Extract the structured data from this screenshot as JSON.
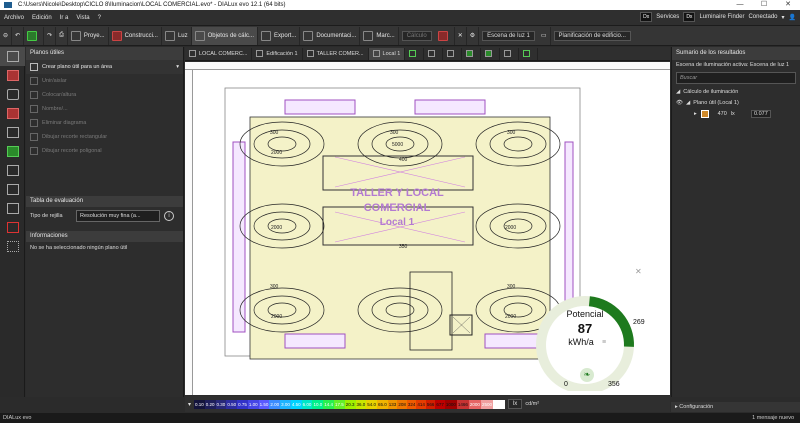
{
  "window": {
    "title": "C:\\Users\\Nicole\\Desktop\\CICLO 8\\Iluminacion\\LOCAL COMERCIAL.evo* - DIALux evo 12.1  (64 bits)"
  },
  "menu": {
    "items": [
      "Archivo",
      "Edición",
      "Ir a",
      "Vista",
      "?"
    ],
    "services": "Services",
    "luminaire_finder": "Luminaire Finder",
    "connection": "Conectado"
  },
  "toolbar": {
    "items": [
      "Proye...",
      "Construcci...",
      "Luz",
      "Objetos de cálc...",
      "Export...",
      "Documentaci...",
      "Marc..."
    ],
    "cálculo": "Cálculo",
    "scene": "Escena de luz 1",
    "building_plan": "Planificación de edificio..."
  },
  "left_panel": {
    "title": "Planos útiles",
    "actions": [
      "Crear plano útil para un área",
      "Unir/aislar",
      "Colocar/altura",
      "Nombre/...",
      "Eliminar diagrama",
      "Dibujar recorte rectangular",
      "Dibujar recorte poligonal"
    ],
    "eval_table_title": "Tabla de evaluación",
    "grid_label": "Tipo de rejilla",
    "grid_value": "Resolución muy fina (a...",
    "info_title": "Informaciones",
    "info_message": "No se ha seleccionado ningún plano útil"
  },
  "view_tabs": [
    "LOCAL COMERC...",
    "Edificación 1",
    "TALLER COMER...",
    "Local 1"
  ],
  "plan": {
    "title_line1": "TALLER Y LOCAL",
    "title_line2": "COMERCIAL",
    "title_line3": "Local 1",
    "iso_labels": [
      "300",
      "350",
      "400",
      "2000",
      "5000"
    ]
  },
  "gauge": {
    "label": "Potencial",
    "value": "87",
    "unit": "kWh/a",
    "min": "0",
    "max_left": "356",
    "max_right": "269",
    "fill_fraction": 0.24
  },
  "color_scale": {
    "values": [
      "0.10",
      "0.20",
      "0.30",
      "0.50",
      "0.75",
      "1.00",
      "1.50",
      "2.00",
      "3.00",
      "4.50",
      "6.00",
      "10.0",
      "14.4",
      "17.5",
      "20.3",
      "36.0",
      "54.0",
      "65.0",
      "133",
      "208",
      "324",
      "414",
      "566",
      "677",
      "1000",
      "1466",
      "2000",
      "2500",
      "5000"
    ],
    "unit1": "lx",
    "unit2": "cd/m²"
  },
  "right_panel": {
    "title": "Sumario de los resultados",
    "active_scene": "Escena de iluminación activa: Escena de luz 1",
    "search_placeholder": "Buscar",
    "calc_heading": "Cálculo de iluminación",
    "plane": "Plano útil (Local 1)",
    "value": "470",
    "unit": "lx",
    "ratio": "0.077",
    "config": "Configuración"
  },
  "status": {
    "left": "DIALux evo",
    "right": "1 mensaje nuevo"
  }
}
